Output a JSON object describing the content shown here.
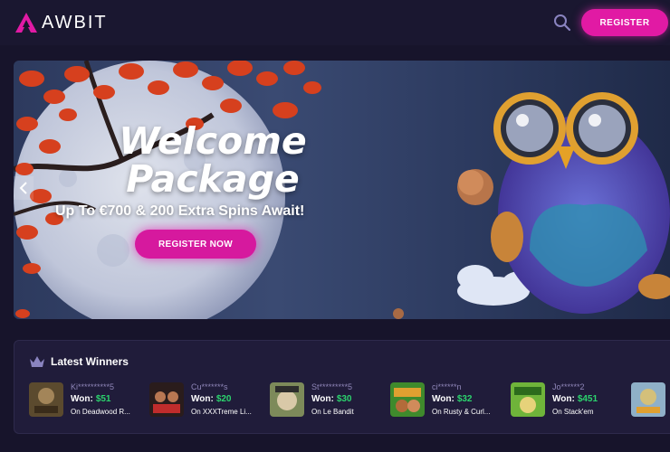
{
  "header": {
    "logo_text": "AWBIT",
    "register_label": "REGISTER"
  },
  "banner": {
    "title_line1": "Welcome",
    "title_line2": "Package",
    "subtitle": "Up To €700 & 200 Extra Spins Await!",
    "cta_label": "REGISTER NOW"
  },
  "winners": {
    "title": "Latest Winners",
    "won_label": "Won:",
    "items": [
      {
        "name": "Ki**********5",
        "amount": "$51",
        "game": "On Deadwood R..."
      },
      {
        "name": "Cu*******s",
        "amount": "$20",
        "game": "On XXXTreme Li..."
      },
      {
        "name": "St*********5",
        "amount": "$30",
        "game": "On Le Bandit"
      },
      {
        "name": "ci******n",
        "amount": "$32",
        "game": "On Rusty & Curl..."
      },
      {
        "name": "Jo******2",
        "amount": "$451",
        "game": "On Stack'em"
      }
    ]
  },
  "colors": {
    "accent": "#e11aa4",
    "win_green": "#2bd36d",
    "background": "#17142b"
  }
}
